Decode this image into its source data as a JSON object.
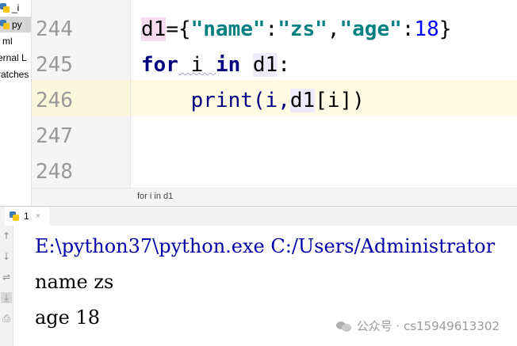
{
  "sidebar": {
    "items": [
      {
        "label": "_i"
      },
      {
        "label": "py"
      },
      {
        "label": "ml"
      },
      {
        "label": "ernal L"
      },
      {
        "label": "ratches"
      }
    ]
  },
  "editor": {
    "line_numbers": [
      "244",
      "245",
      "246",
      "247",
      "248"
    ],
    "lines": {
      "l244": {
        "var": "d1",
        "eq": "=",
        "open": "{",
        "k1": "\"name\"",
        "c1": ":",
        "v1": "\"zs\"",
        "comma": ",",
        "k2": "\"age\"",
        "c2": ":",
        "v2": "18",
        "close": "}"
      },
      "l245": {
        "for": "for",
        "i": " i ",
        "in": "in",
        "d1": "d1",
        "colon": ":"
      },
      "l246": {
        "indent": "    ",
        "print": "print(i,",
        "d1": "d1",
        "rest": "[i])"
      }
    },
    "breadcrumb": "for i in d1"
  },
  "run_panel": {
    "tab_label": "1",
    "tab_close": "×",
    "output": [
      "E:\\python37\\python.exe C:/Users/Administrator",
      "name zs",
      "age 18"
    ]
  },
  "watermark": {
    "text": "公众号 · cs15949613302"
  }
}
